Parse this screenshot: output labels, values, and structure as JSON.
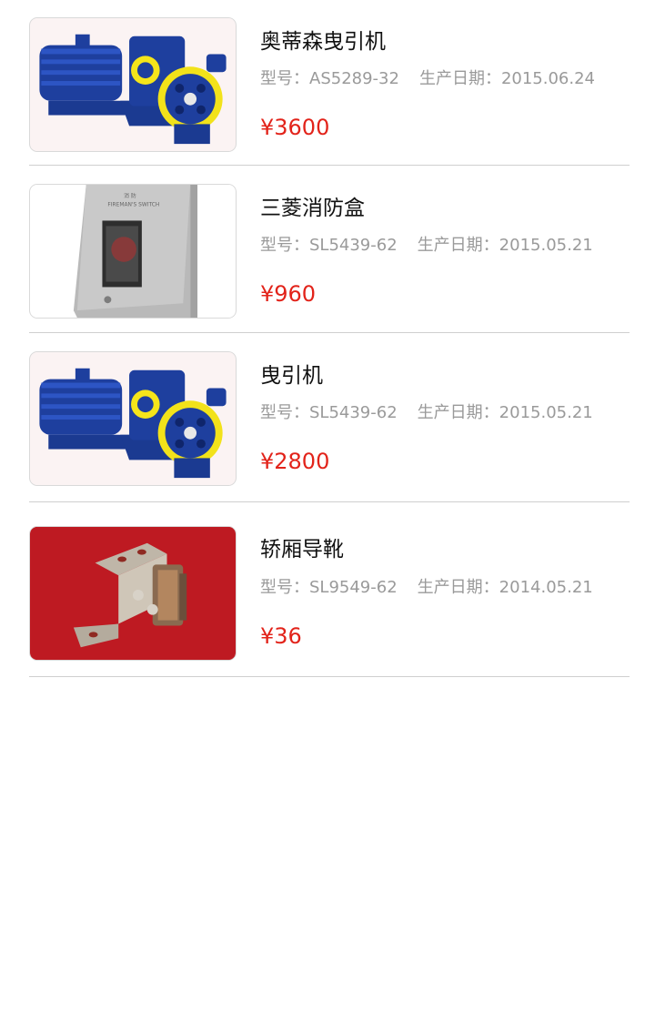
{
  "labels": {
    "model": "型号：",
    "date": "生产日期：",
    "currency": "¥"
  },
  "products": [
    {
      "name": "奥蒂森曳引机",
      "model": "AS5289-32",
      "date": "2015.06.24",
      "price": "¥3600",
      "image": "traction-machine-image"
    },
    {
      "name": "三菱消防盒",
      "model": "SL5439-62",
      "date": "2015.05.21",
      "price": "¥960",
      "image": "fire-switch-box-image"
    },
    {
      "name": "曳引机",
      "model": "SL5439-62",
      "date": "2015.05.21",
      "price": "¥2800",
      "image": "traction-machine-image"
    },
    {
      "name": "轿厢导靴",
      "model": "SL9549-62",
      "date": "2014.05.21",
      "price": "¥36",
      "image": "car-guide-shoe-image"
    }
  ],
  "colors": {
    "price": "#e2231a",
    "meta": "#9a9a9a",
    "divider": "#cfcfcf"
  }
}
